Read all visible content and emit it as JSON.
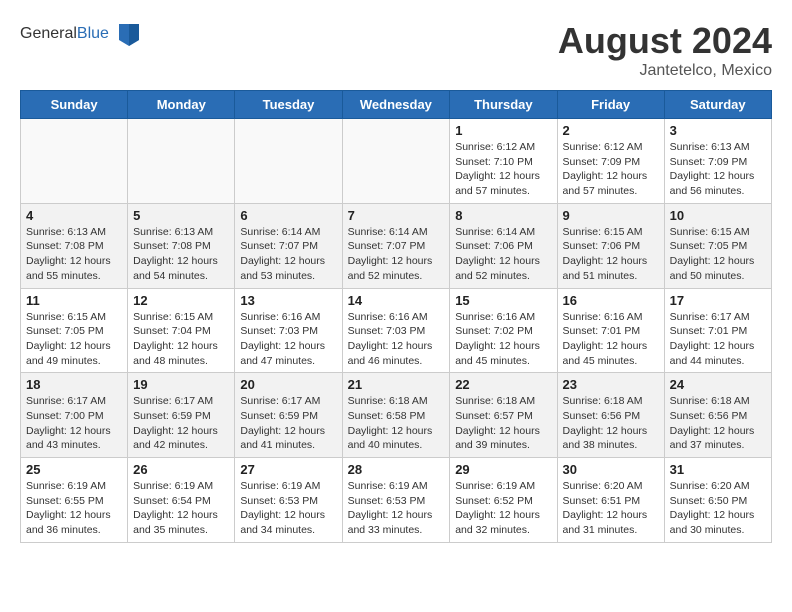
{
  "header": {
    "logo_general": "General",
    "logo_blue": "Blue",
    "month_year": "August 2024",
    "location": "Jantetelco, Mexico"
  },
  "days_of_week": [
    "Sunday",
    "Monday",
    "Tuesday",
    "Wednesday",
    "Thursday",
    "Friday",
    "Saturday"
  ],
  "weeks": [
    [
      {
        "day": "",
        "info": ""
      },
      {
        "day": "",
        "info": ""
      },
      {
        "day": "",
        "info": ""
      },
      {
        "day": "",
        "info": ""
      },
      {
        "day": "1",
        "sunrise": "6:12 AM",
        "sunset": "7:10 PM",
        "daylight": "12 hours and 57 minutes."
      },
      {
        "day": "2",
        "sunrise": "6:12 AM",
        "sunset": "7:09 PM",
        "daylight": "12 hours and 57 minutes."
      },
      {
        "day": "3",
        "sunrise": "6:13 AM",
        "sunset": "7:09 PM",
        "daylight": "12 hours and 56 minutes."
      }
    ],
    [
      {
        "day": "4",
        "sunrise": "6:13 AM",
        "sunset": "7:08 PM",
        "daylight": "12 hours and 55 minutes."
      },
      {
        "day": "5",
        "sunrise": "6:13 AM",
        "sunset": "7:08 PM",
        "daylight": "12 hours and 54 minutes."
      },
      {
        "day": "6",
        "sunrise": "6:14 AM",
        "sunset": "7:07 PM",
        "daylight": "12 hours and 53 minutes."
      },
      {
        "day": "7",
        "sunrise": "6:14 AM",
        "sunset": "7:07 PM",
        "daylight": "12 hours and 52 minutes."
      },
      {
        "day": "8",
        "sunrise": "6:14 AM",
        "sunset": "7:06 PM",
        "daylight": "12 hours and 52 minutes."
      },
      {
        "day": "9",
        "sunrise": "6:15 AM",
        "sunset": "7:06 PM",
        "daylight": "12 hours and 51 minutes."
      },
      {
        "day": "10",
        "sunrise": "6:15 AM",
        "sunset": "7:05 PM",
        "daylight": "12 hours and 50 minutes."
      }
    ],
    [
      {
        "day": "11",
        "sunrise": "6:15 AM",
        "sunset": "7:05 PM",
        "daylight": "12 hours and 49 minutes."
      },
      {
        "day": "12",
        "sunrise": "6:15 AM",
        "sunset": "7:04 PM",
        "daylight": "12 hours and 48 minutes."
      },
      {
        "day": "13",
        "sunrise": "6:16 AM",
        "sunset": "7:03 PM",
        "daylight": "12 hours and 47 minutes."
      },
      {
        "day": "14",
        "sunrise": "6:16 AM",
        "sunset": "7:03 PM",
        "daylight": "12 hours and 46 minutes."
      },
      {
        "day": "15",
        "sunrise": "6:16 AM",
        "sunset": "7:02 PM",
        "daylight": "12 hours and 45 minutes."
      },
      {
        "day": "16",
        "sunrise": "6:16 AM",
        "sunset": "7:01 PM",
        "daylight": "12 hours and 45 minutes."
      },
      {
        "day": "17",
        "sunrise": "6:17 AM",
        "sunset": "7:01 PM",
        "daylight": "12 hours and 44 minutes."
      }
    ],
    [
      {
        "day": "18",
        "sunrise": "6:17 AM",
        "sunset": "7:00 PM",
        "daylight": "12 hours and 43 minutes."
      },
      {
        "day": "19",
        "sunrise": "6:17 AM",
        "sunset": "6:59 PM",
        "daylight": "12 hours and 42 minutes."
      },
      {
        "day": "20",
        "sunrise": "6:17 AM",
        "sunset": "6:59 PM",
        "daylight": "12 hours and 41 minutes."
      },
      {
        "day": "21",
        "sunrise": "6:18 AM",
        "sunset": "6:58 PM",
        "daylight": "12 hours and 40 minutes."
      },
      {
        "day": "22",
        "sunrise": "6:18 AM",
        "sunset": "6:57 PM",
        "daylight": "12 hours and 39 minutes."
      },
      {
        "day": "23",
        "sunrise": "6:18 AM",
        "sunset": "6:56 PM",
        "daylight": "12 hours and 38 minutes."
      },
      {
        "day": "24",
        "sunrise": "6:18 AM",
        "sunset": "6:56 PM",
        "daylight": "12 hours and 37 minutes."
      }
    ],
    [
      {
        "day": "25",
        "sunrise": "6:19 AM",
        "sunset": "6:55 PM",
        "daylight": "12 hours and 36 minutes."
      },
      {
        "day": "26",
        "sunrise": "6:19 AM",
        "sunset": "6:54 PM",
        "daylight": "12 hours and 35 minutes."
      },
      {
        "day": "27",
        "sunrise": "6:19 AM",
        "sunset": "6:53 PM",
        "daylight": "12 hours and 34 minutes."
      },
      {
        "day": "28",
        "sunrise": "6:19 AM",
        "sunset": "6:53 PM",
        "daylight": "12 hours and 33 minutes."
      },
      {
        "day": "29",
        "sunrise": "6:19 AM",
        "sunset": "6:52 PM",
        "daylight": "12 hours and 32 minutes."
      },
      {
        "day": "30",
        "sunrise": "6:20 AM",
        "sunset": "6:51 PM",
        "daylight": "12 hours and 31 minutes."
      },
      {
        "day": "31",
        "sunrise": "6:20 AM",
        "sunset": "6:50 PM",
        "daylight": "12 hours and 30 minutes."
      }
    ]
  ]
}
